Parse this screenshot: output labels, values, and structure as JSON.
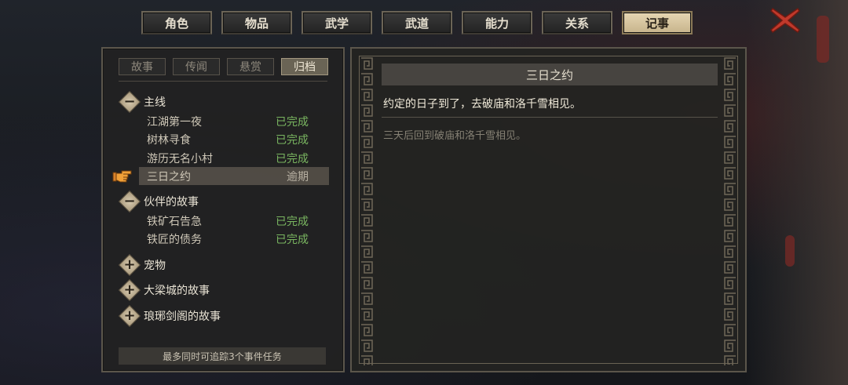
{
  "tabs": [
    {
      "label": "角色",
      "active": false
    },
    {
      "label": "物品",
      "active": false
    },
    {
      "label": "武学",
      "active": false
    },
    {
      "label": "武道",
      "active": false
    },
    {
      "label": "能力",
      "active": false
    },
    {
      "label": "关系",
      "active": false
    },
    {
      "label": "记事",
      "active": true
    }
  ],
  "subtabs": [
    {
      "label": "故事",
      "active": false
    },
    {
      "label": "传闻",
      "active": false
    },
    {
      "label": "悬赏",
      "active": false
    },
    {
      "label": "归档",
      "active": true
    }
  ],
  "categories": {
    "main": {
      "label": "主线",
      "expanded": true,
      "icon": "minus"
    },
    "companion": {
      "label": "伙伴的故事",
      "expanded": true,
      "icon": "minus"
    },
    "pet": {
      "label": "宠物",
      "expanded": false,
      "icon": "plus"
    },
    "daliang": {
      "label": "大梁城的故事",
      "expanded": false,
      "icon": "plus"
    },
    "langya": {
      "label": "琅琊剑阁的故事",
      "expanded": false,
      "icon": "plus"
    }
  },
  "quests": [
    {
      "name": "江湖第一夜",
      "status": "已完成"
    },
    {
      "name": "树林寻食",
      "status": "已完成"
    },
    {
      "name": "游历无名小村",
      "status": "已完成"
    },
    {
      "name": "三日之约",
      "status": "逾期",
      "selected": true
    },
    {
      "name": "铁矿石告急",
      "status": "已完成"
    },
    {
      "name": "铁匠的债务",
      "status": "已完成"
    }
  ],
  "hint": "最多同时可追踪3个事件任务",
  "detail": {
    "title": "三日之约",
    "description": "约定的日子到了，去破庙和洛千雪相见。",
    "objective": "三天后回到破庙和洛千雪相见。"
  },
  "colors": {
    "completed": "#79b560",
    "overdue": "#b7b0a2",
    "close_red": "#c0392b"
  }
}
